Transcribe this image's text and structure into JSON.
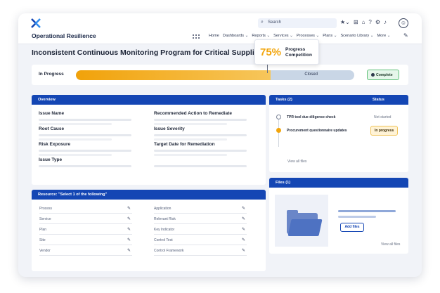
{
  "app": {
    "title": "Operational Resilience"
  },
  "search": {
    "placeholder": "Search"
  },
  "nav": {
    "items": [
      "Home",
      "Dashboards ⌄",
      "Reports ⌄",
      "Services ⌄",
      "Processes ⌄",
      "Plans ⌄",
      "Scenario Library ⌄",
      "More ⌄"
    ]
  },
  "page": {
    "title": "Inconsistent Continuous Monitoring Program for Critical Suppliers"
  },
  "callout": {
    "percent": "75%",
    "label": "Progress Competition"
  },
  "progress": {
    "status": "In Progress",
    "closed_label": "Closed",
    "fill_fraction": 0.7,
    "complete_button": "Complete"
  },
  "overview": {
    "title": "Overview",
    "fields": [
      "Issue Name",
      "Recommended Action to Remediate",
      "Root Cause",
      "Issue Severity",
      "Risk Exposure",
      "Target Date for Remediation",
      "Issue Type"
    ]
  },
  "resource": {
    "title": "Resource: \"Select 1 of the following\"",
    "left_items": [
      "Process",
      "Service",
      "Plan",
      "Site",
      "Vendor"
    ],
    "right_items": [
      "Application",
      "Relevant Risk",
      "Key Indicator",
      "Control Test",
      "Control Framework"
    ]
  },
  "tasks": {
    "title": "Tasks (2)",
    "status_header": "Status",
    "items": [
      {
        "name": "TPR tool due diligence check",
        "status": "Not started"
      },
      {
        "name": "Procurement questionnaire updates",
        "status": "In progress"
      }
    ],
    "view_all": "View all files"
  },
  "files": {
    "title": "Files (1)",
    "add_button": "Add files",
    "view_all": "View all files"
  },
  "colors": {
    "primary": "#1446b4",
    "accent": "#f2a50c",
    "success": "#61c17a"
  }
}
